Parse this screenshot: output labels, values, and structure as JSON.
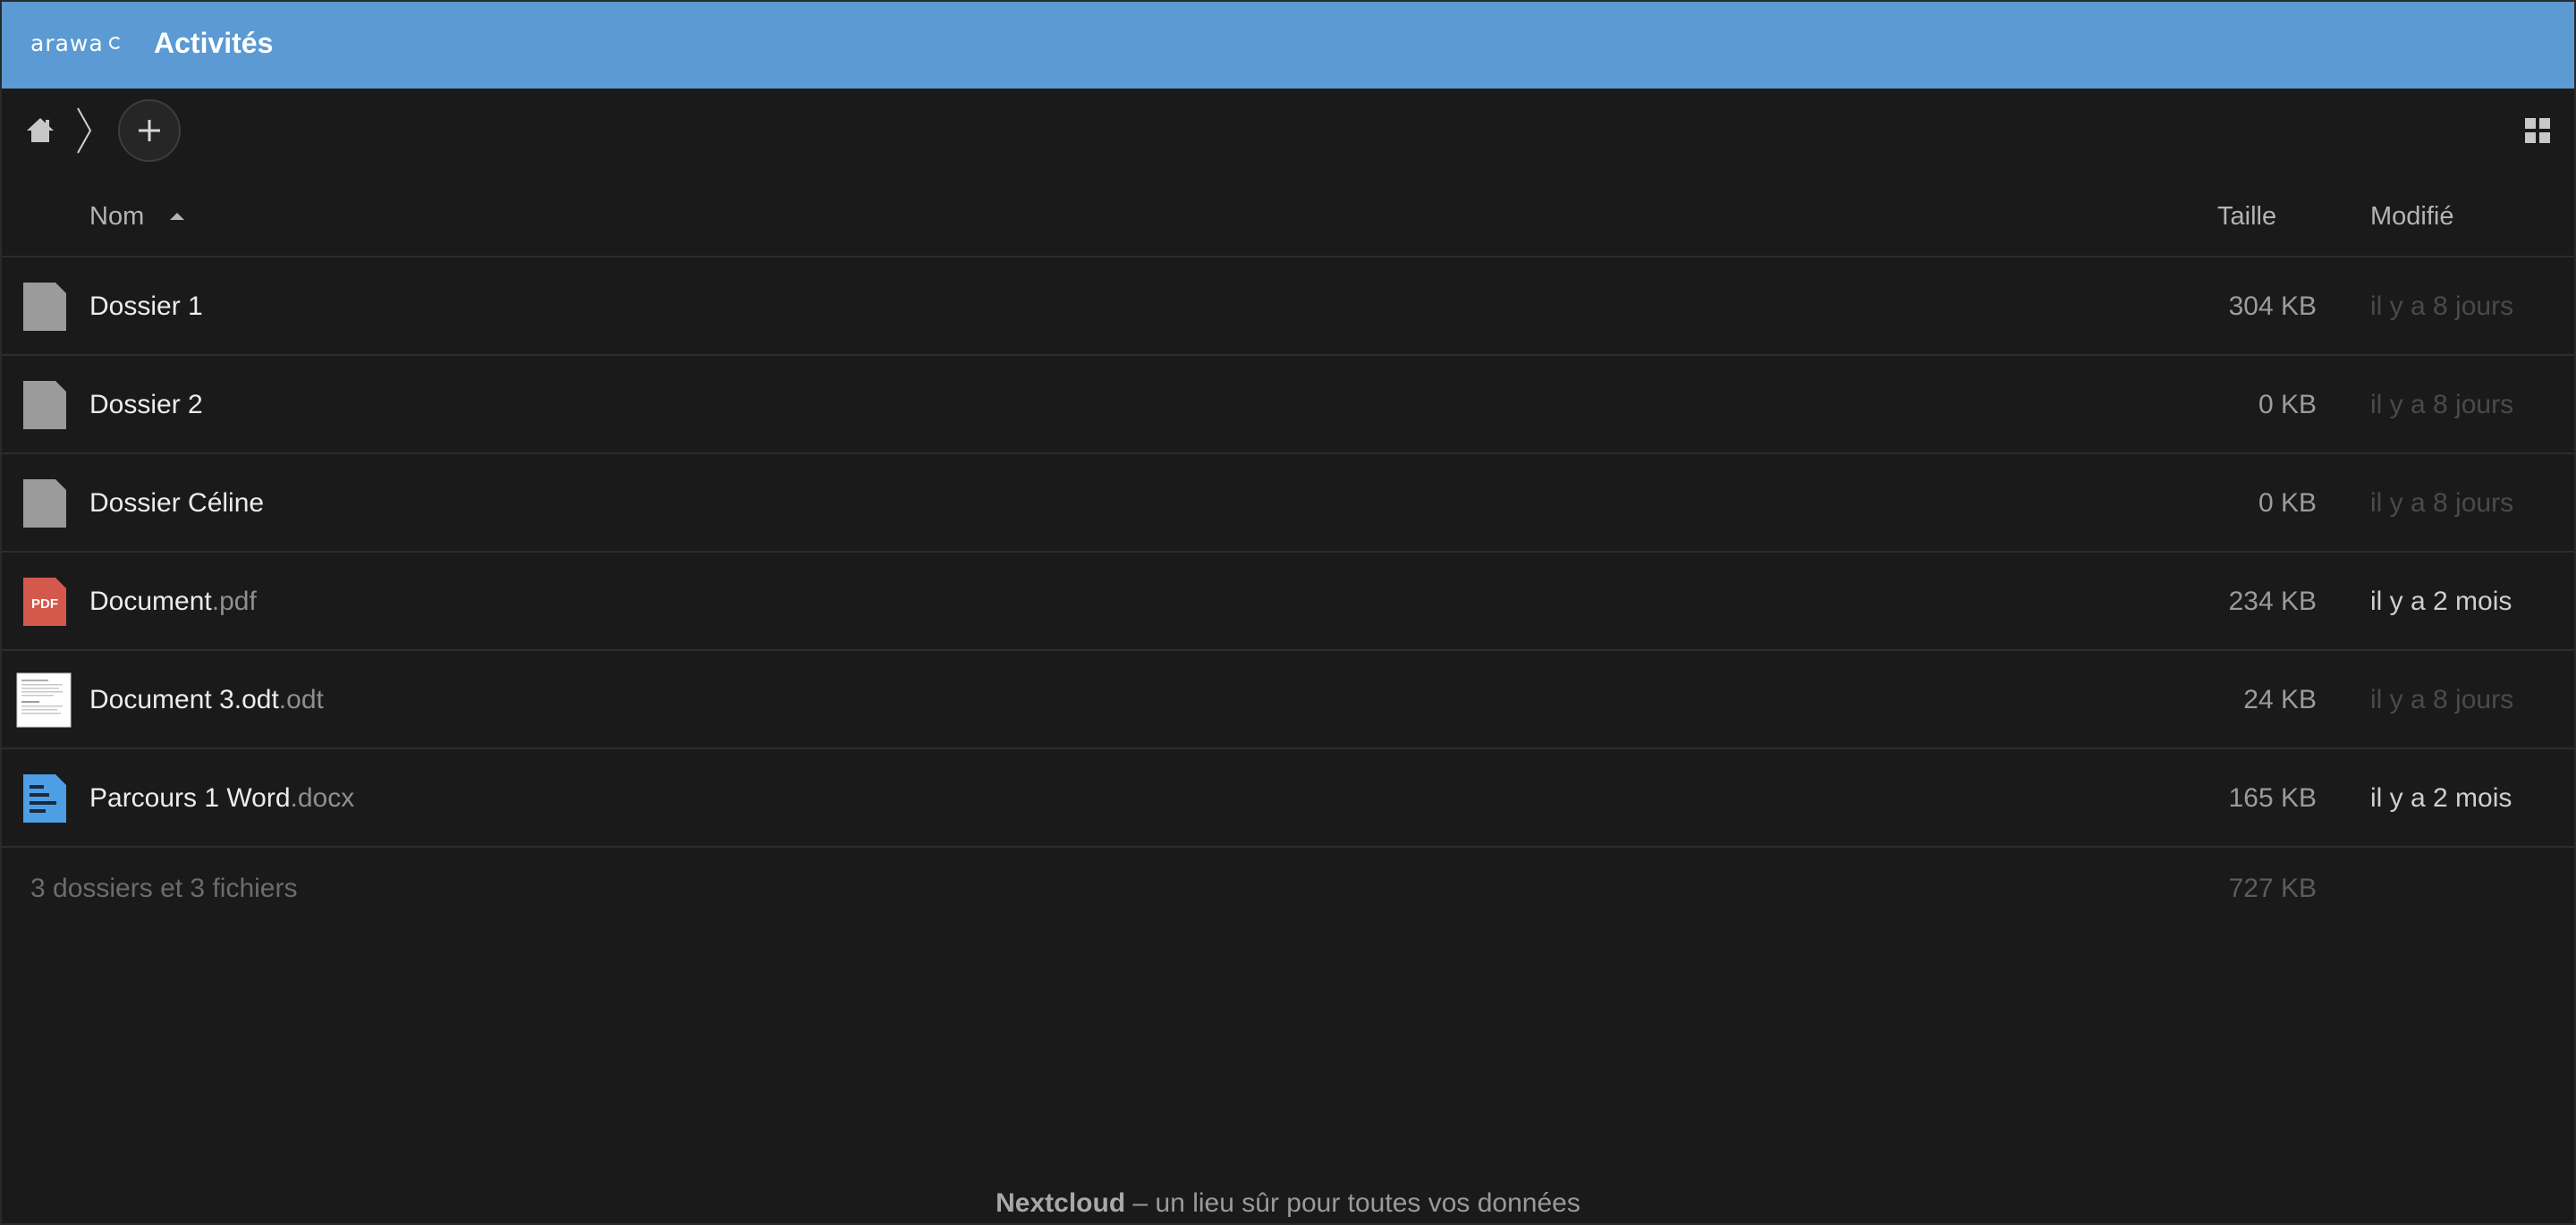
{
  "header": {
    "logo_text": "arawa",
    "app_title": "Activités",
    "accent_color": "#5b9ad2"
  },
  "toolbar": {
    "home_icon": "home-icon",
    "breadcrumb_separator_icon": "chevron-right-icon",
    "add_icon": "plus-icon",
    "view_toggle_icon": "grid-view-icon"
  },
  "table": {
    "columns": {
      "name": "Nom",
      "size": "Taille",
      "modified": "Modifié"
    },
    "rows": [
      {
        "icon": "folder-icon",
        "name": "Dossier 1",
        "ext": "",
        "size": "304 KB",
        "modified": "il y a 8 jours"
      },
      {
        "icon": "folder-icon",
        "name": "Dossier 2",
        "ext": "",
        "size": "0 KB",
        "modified": "il y a 8 jours"
      },
      {
        "icon": "folder-icon",
        "name": "Dossier Céline",
        "ext": "",
        "size": "0 KB",
        "modified": "il y a 8 jours"
      },
      {
        "icon": "pdf-icon",
        "icon_label": "PDF",
        "name": "Document",
        "ext": ".pdf",
        "size": "234 KB",
        "modified": "il y a 2 mois"
      },
      {
        "icon": "document-thumbnail-icon",
        "name": "Document 3.odt",
        "ext": ".odt",
        "size": "24 KB",
        "modified": "il y a 8 jours"
      },
      {
        "icon": "word-document-icon",
        "name": "Parcours 1 Word",
        "ext": ".docx",
        "size": "165 KB",
        "modified": "il y a 2 mois"
      }
    ]
  },
  "summary": {
    "text": "3 dossiers et 3 fichiers",
    "total_size": "727 KB"
  },
  "footer": {
    "brand": "Nextcloud",
    "tagline": " – un lieu sûr pour toutes vos données"
  }
}
